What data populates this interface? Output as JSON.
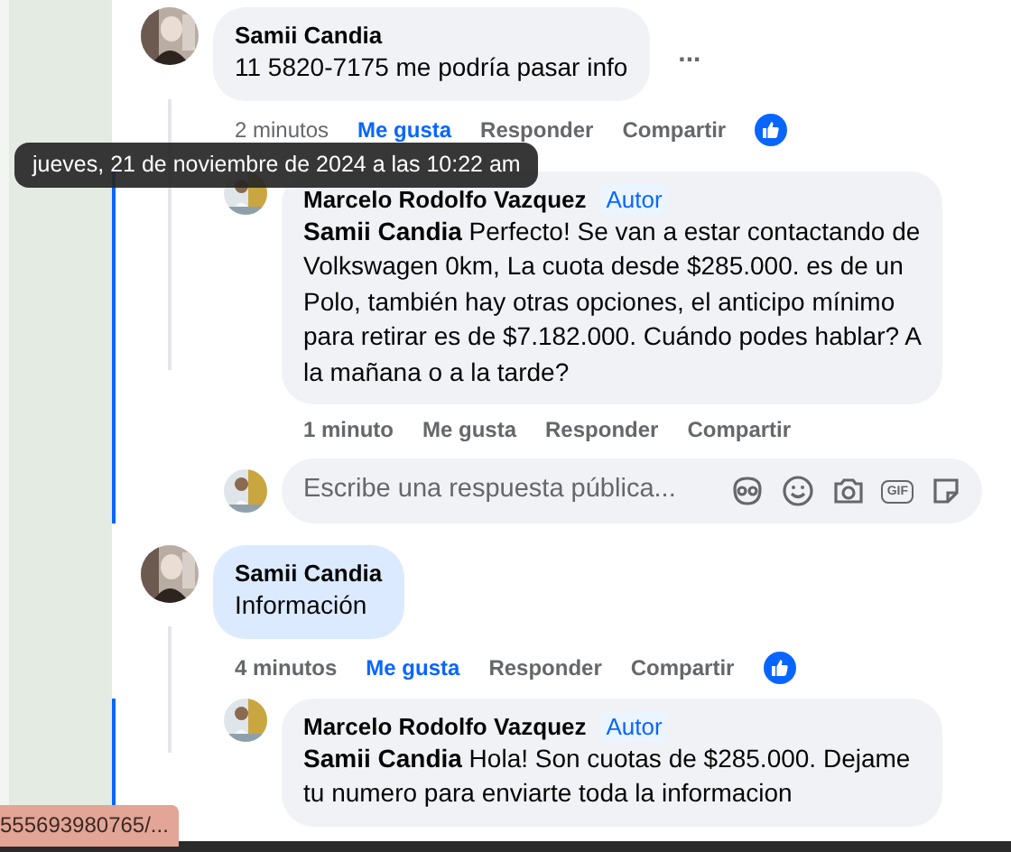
{
  "comments": [
    {
      "author": "Samii Candia",
      "text": "11 5820-7175 me podría pasar info",
      "highlighted": false,
      "more": "...",
      "time": "2 minutos",
      "time_hovered": true,
      "like": "Me gusta",
      "liked": true,
      "reply_label": "Responder",
      "share": "Compartir",
      "reacted": true,
      "replies": [
        {
          "author": "Marcelo Rodolfo Vazquez",
          "badge": "Autor",
          "text": "**Samii Candia** Perfecto! Se van a estar contactando de Volkswagen 0km, La cuota desde $285.000. es de un Polo, también hay otras opciones, el anticipo mínimo para retirar es de $7.182.000. Cuándo podes hablar? A la mañana o a la tarde?",
          "time": "1 minuto",
          "like": "Me gusta",
          "liked": false,
          "reply_label": "Responder",
          "share": "Compartir"
        }
      ],
      "reply_box": {
        "placeholder": "Escribe una respuesta pública...",
        "gif_label": "GIF"
      }
    },
    {
      "author": "Samii Candia",
      "text": "Información",
      "highlighted": true,
      "time": "4 minutos",
      "time_hovered": false,
      "like": "Me gusta",
      "liked": true,
      "reply_label": "Responder",
      "share": "Compartir",
      "reacted": true,
      "replies": [
        {
          "author": "Marcelo Rodolfo Vazquez",
          "badge": "Autor",
          "text": "**Samii Candia** Hola! Son cuotas de $285.000. Dejame tu numero para enviarte toda la informacion"
        }
      ]
    }
  ],
  "tooltip": "jueves, 21 de noviembre de 2024 a las 10:22 am",
  "status_url": "555693980765/..."
}
